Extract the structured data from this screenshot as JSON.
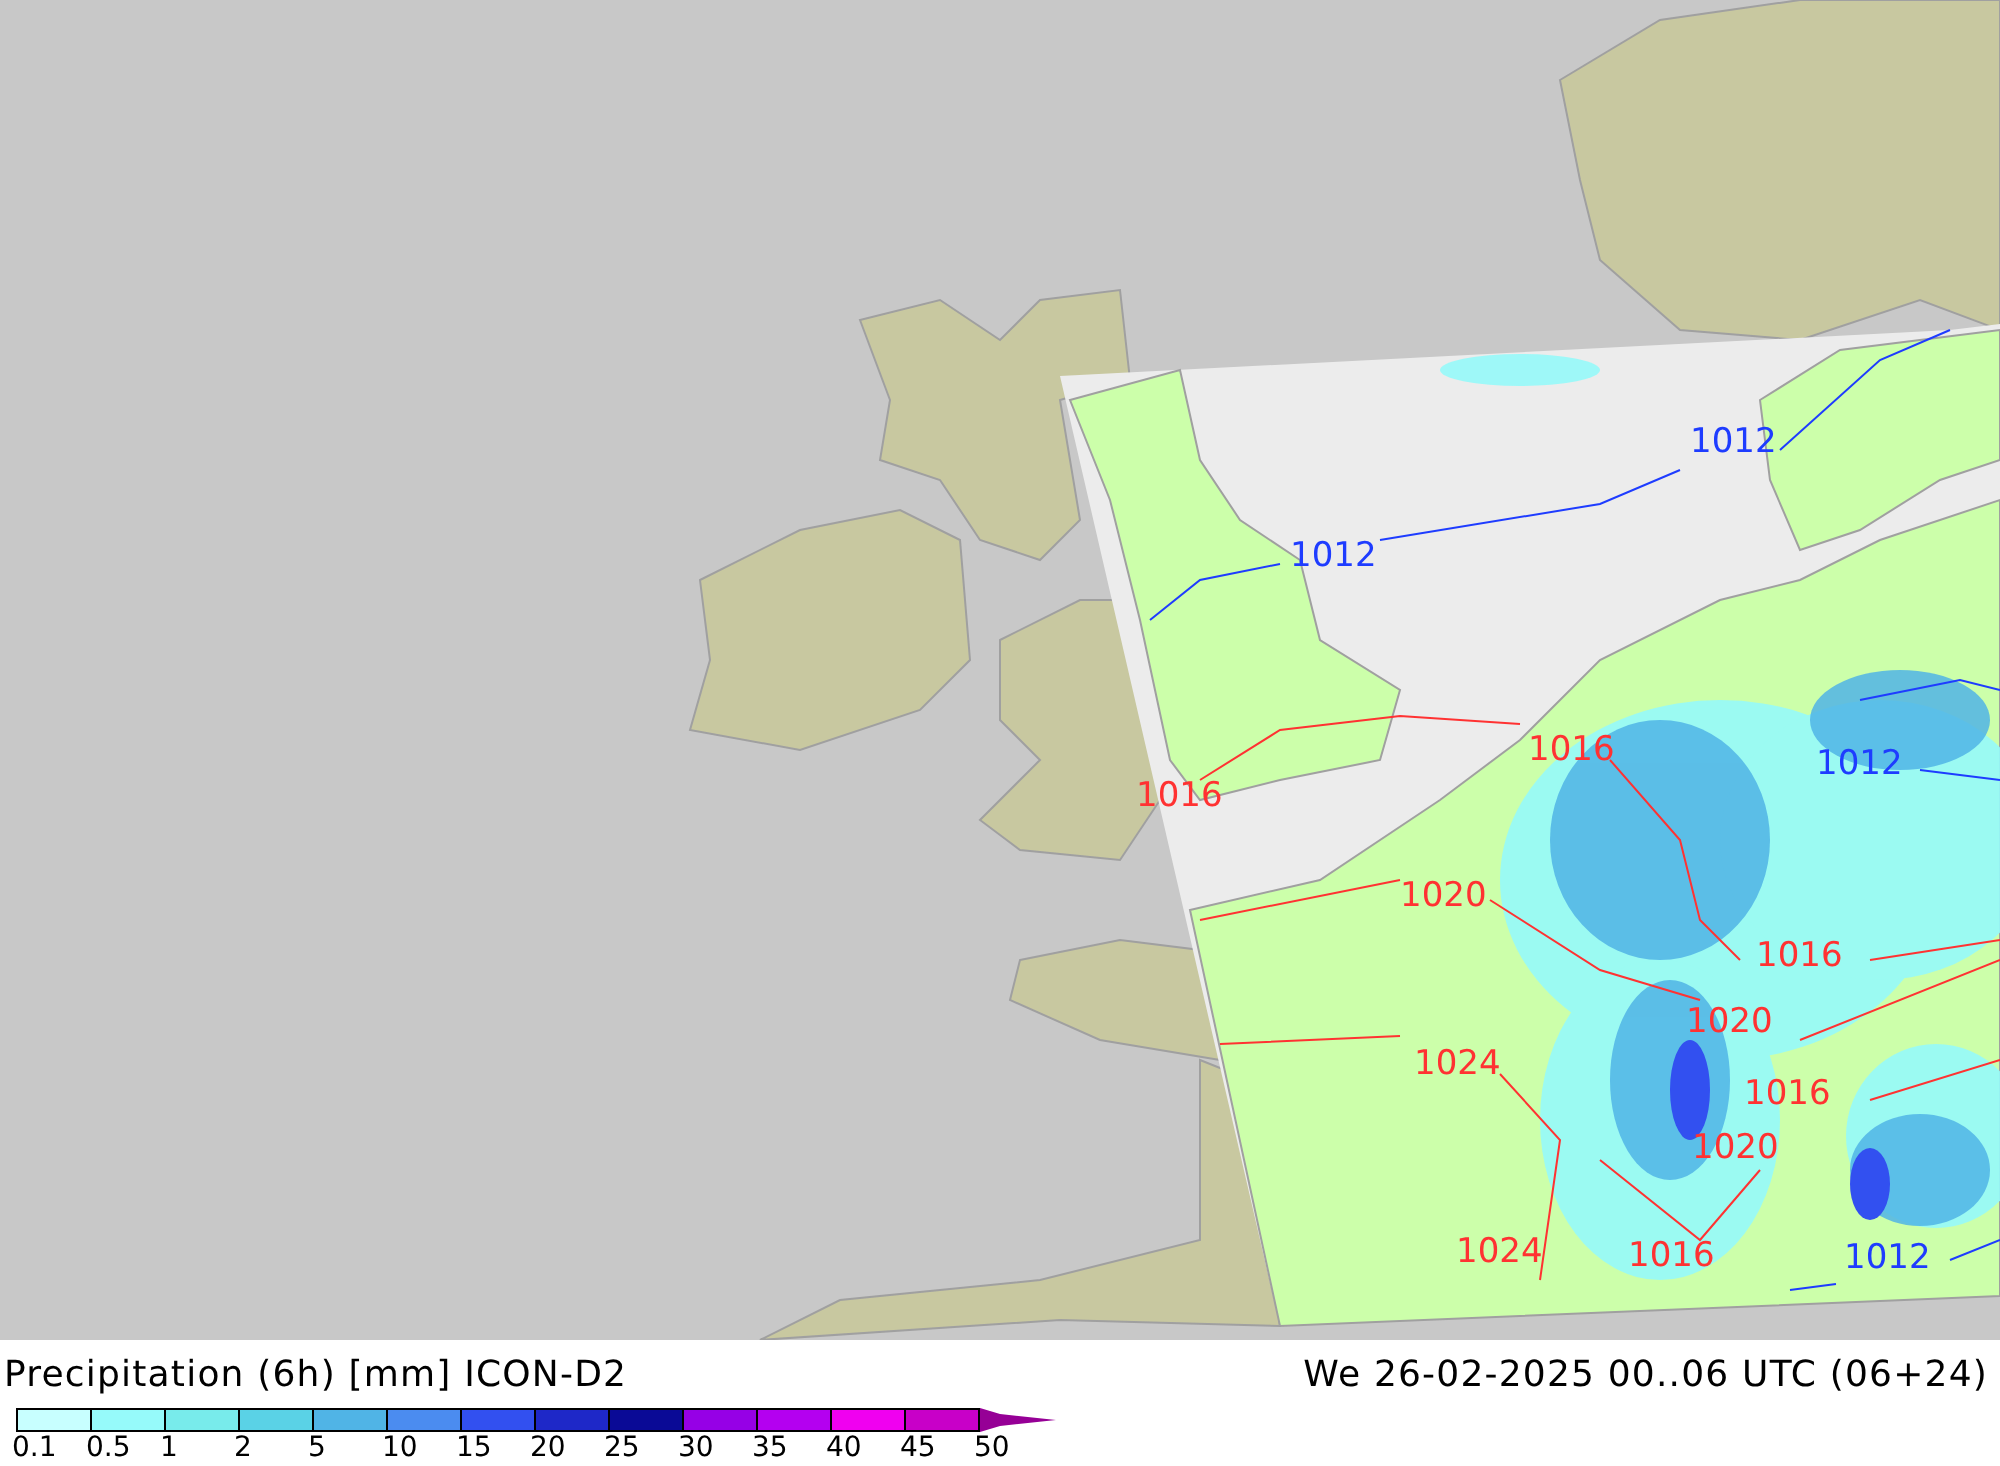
{
  "map": {
    "isobar_labels": [
      {
        "text": "1012",
        "color": "#1e3cff"
      },
      {
        "text": "1012",
        "color": "#1e3cff"
      },
      {
        "text": "1016",
        "color": "#ff3232"
      },
      {
        "text": "1016",
        "color": "#ff3232"
      },
      {
        "text": "1012",
        "color": "#1e3cff"
      },
      {
        "text": "1020",
        "color": "#ff3232"
      },
      {
        "text": "1016",
        "color": "#ff3232"
      },
      {
        "text": "1020",
        "color": "#ff3232"
      },
      {
        "text": "1024",
        "color": "#ff3232"
      },
      {
        "text": "1016",
        "color": "#ff3232"
      },
      {
        "text": "1020",
        "color": "#ff3232"
      },
      {
        "text": "1024",
        "color": "#ff3232"
      },
      {
        "text": "1016",
        "color": "#ff3232"
      },
      {
        "text": "1012",
        "color": "#1e3cff"
      }
    ]
  },
  "title": "Precipitation (6h) [mm] ICON-D2",
  "valid_time": "We 26-02-2025 00..06 UTC (06+24)",
  "legend": {
    "swatches": [
      {
        "color": "#c8ffff"
      },
      {
        "color": "#96fafa"
      },
      {
        "color": "#78ebeb"
      },
      {
        "color": "#5ad2e6"
      },
      {
        "color": "#50b4e6"
      },
      {
        "color": "#4b8cf0"
      },
      {
        "color": "#3250f0"
      },
      {
        "color": "#1e28c8"
      },
      {
        "color": "#0a0a96"
      },
      {
        "color": "#9600e6"
      },
      {
        "color": "#b400f0"
      },
      {
        "color": "#f000f0"
      },
      {
        "color": "#c800c8"
      }
    ],
    "ticks": [
      "0.1",
      "0.5",
      "1",
      "2",
      "5",
      "10",
      "15",
      "20",
      "25",
      "30",
      "35",
      "40",
      "45",
      "50"
    ]
  }
}
